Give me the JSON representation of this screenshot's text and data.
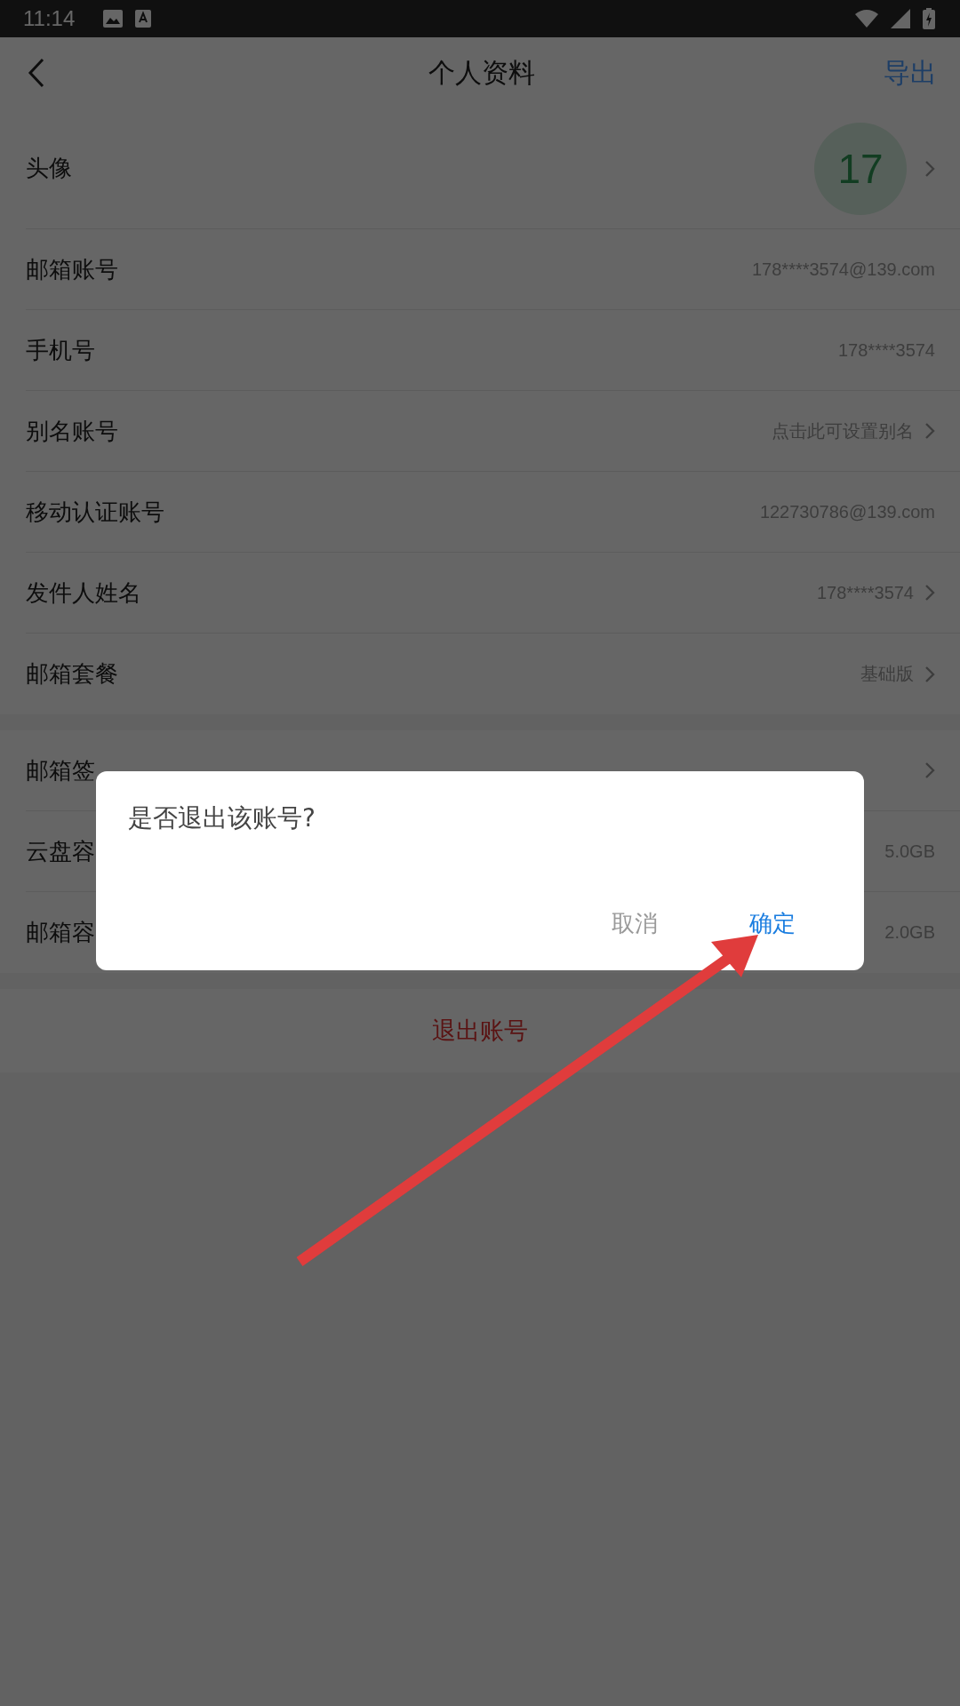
{
  "status_bar": {
    "time": "11:14"
  },
  "nav": {
    "title": "个人资料",
    "action": "导出"
  },
  "sections": [
    {
      "rows": [
        {
          "label": "头像",
          "value": "17",
          "kind": "avatar",
          "chevron": true
        },
        {
          "label": "邮箱账号",
          "value": "178****3574@139.com",
          "kind": "text",
          "chevron": false
        },
        {
          "label": "手机号",
          "value": "178****3574",
          "kind": "text",
          "chevron": false
        },
        {
          "label": "别名账号",
          "value": "点击此可设置别名",
          "kind": "text",
          "chevron": true
        },
        {
          "label": "移动认证账号",
          "value": "122730786@139.com",
          "kind": "text",
          "chevron": false
        },
        {
          "label": "发件人姓名",
          "value": "178****3574",
          "kind": "text",
          "chevron": true
        },
        {
          "label": "邮箱套餐",
          "value": "基础版",
          "kind": "text",
          "chevron": true
        }
      ]
    },
    {
      "rows": [
        {
          "label": "邮箱签",
          "kind": "text",
          "chevron": true
        },
        {
          "label": "云盘容",
          "value": "5.0GB",
          "kind": "text",
          "chevron": false
        },
        {
          "label": "邮箱容",
          "value": "2.0GB",
          "kind": "text",
          "chevron": false
        }
      ]
    }
  ],
  "logout": {
    "label": "退出账号"
  },
  "dialog": {
    "message": "是否退出该账号?",
    "buttons": [
      {
        "label": "取消",
        "kind": "cancel"
      },
      {
        "label": "确定",
        "kind": "confirm"
      }
    ]
  }
}
